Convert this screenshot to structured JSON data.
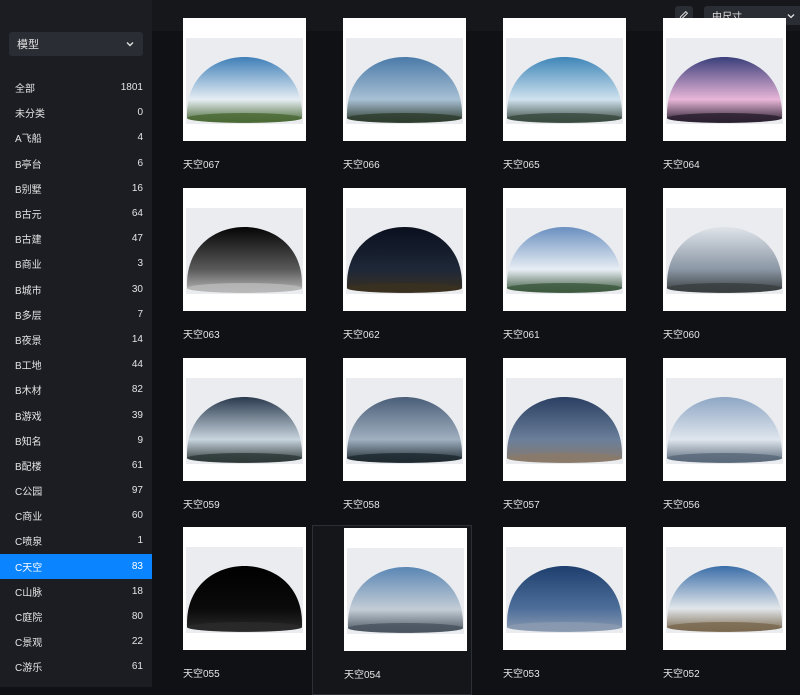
{
  "filter": {
    "selected": "模型"
  },
  "categories": [
    {
      "name": "全部",
      "count": "1801"
    },
    {
      "name": "未分类",
      "count": "0"
    },
    {
      "name": "A飞船",
      "count": "4"
    },
    {
      "name": "B亭台",
      "count": "6"
    },
    {
      "name": "B别墅",
      "count": "16"
    },
    {
      "name": "B古元",
      "count": "64"
    },
    {
      "name": "B古建",
      "count": "47"
    },
    {
      "name": "B商业",
      "count": "3"
    },
    {
      "name": "B城市",
      "count": "30"
    },
    {
      "name": "B多层",
      "count": "7"
    },
    {
      "name": "B夜景",
      "count": "14"
    },
    {
      "name": "B工地",
      "count": "44"
    },
    {
      "name": "B木材",
      "count": "82"
    },
    {
      "name": "B游戏",
      "count": "39"
    },
    {
      "name": "B知名",
      "count": "9"
    },
    {
      "name": "B配楼",
      "count": "61"
    },
    {
      "name": "C公园",
      "count": "97"
    },
    {
      "name": "C商业",
      "count": "60"
    },
    {
      "name": "C喷泉",
      "count": "1"
    },
    {
      "name": "C天空",
      "count": "83"
    },
    {
      "name": "C山脉",
      "count": "18"
    },
    {
      "name": "C庭院",
      "count": "80"
    },
    {
      "name": "C景观",
      "count": "22"
    },
    {
      "name": "C游乐",
      "count": "61"
    }
  ],
  "active_category": "C天空",
  "toolbar": {
    "size_select": "中尺寸"
  },
  "items": [
    {
      "label": "天空067",
      "top": "#3f7fb8",
      "mid": "#e6eef4",
      "bottom": "#4a6a35"
    },
    {
      "label": "天空066",
      "top": "#4a7aa8",
      "mid": "#a8c0d4",
      "bottom": "#2e3d2e"
    },
    {
      "label": "天空065",
      "top": "#3e86b8",
      "mid": "#cfe2ee",
      "bottom": "#3a4a40"
    },
    {
      "label": "天空064",
      "top": "#3a3f7a",
      "mid": "#e8b6d8",
      "bottom": "#2a2030"
    },
    {
      "label": "天空063",
      "top": "#050505",
      "mid": "#5a5a5a",
      "bottom": "#b8b8b8"
    },
    {
      "label": "天空062",
      "top": "#0a0f1e",
      "mid": "#1e2838",
      "bottom": "#3a3020"
    },
    {
      "label": "天空061",
      "top": "#6a8fc0",
      "mid": "#e8eef4",
      "bottom": "#3d5a40"
    },
    {
      "label": "天空060",
      "top": "#dfe4ea",
      "mid": "#8a96a4",
      "bottom": "#3a3e40"
    },
    {
      "label": "天空059",
      "top": "#2a3a4e",
      "mid": "#c8d4de",
      "bottom": "#2e3a38"
    },
    {
      "label": "天空058",
      "top": "#4a5e78",
      "mid": "#a0b0c0",
      "bottom": "#1e2a30"
    },
    {
      "label": "天空057",
      "top": "#2a3f62",
      "mid": "#6a7f9a",
      "bottom": "#8a7a6a"
    },
    {
      "label": "天空056",
      "top": "#8ea6c4",
      "mid": "#dfe6ee",
      "bottom": "#5a6a7a"
    },
    {
      "label": "天空055",
      "top": "#000000",
      "mid": "#0a0a0a",
      "bottom": "#2a2a2a"
    },
    {
      "label": "天空054",
      "top": "#5a86b4",
      "mid": "#c4cdd6",
      "bottom": "#4a5560"
    },
    {
      "label": "天空053",
      "top": "#1e3f6e",
      "mid": "#4e6e9a",
      "bottom": "#8a9ab0"
    },
    {
      "label": "天空052",
      "top": "#3a6ea8",
      "mid": "#e2e6ea",
      "bottom": "#7a6a50"
    }
  ]
}
